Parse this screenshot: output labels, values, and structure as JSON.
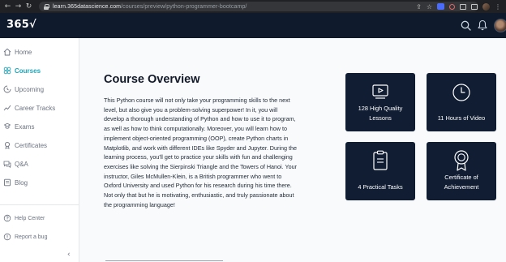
{
  "browser": {
    "url_host": "learn.365datascience.com",
    "url_path": "/courses/preview/python-programmer-bootcamp/"
  },
  "header": {
    "logo": "365√"
  },
  "sidebar": {
    "items": [
      {
        "label": "Home",
        "icon": "home-icon"
      },
      {
        "label": "Courses",
        "icon": "courses-icon",
        "active": true
      },
      {
        "label": "Upcoming",
        "icon": "upcoming-icon"
      },
      {
        "label": "Career Tracks",
        "icon": "career-tracks-icon"
      },
      {
        "label": "Exams",
        "icon": "exams-icon"
      },
      {
        "label": "Certificates",
        "icon": "certificates-icon"
      },
      {
        "label": "Q&A",
        "icon": "qa-icon"
      },
      {
        "label": "Blog",
        "icon": "blog-icon"
      }
    ],
    "footer_items": [
      {
        "label": "Help Center",
        "icon": "help-icon"
      },
      {
        "label": "Report a bug",
        "icon": "bug-icon"
      }
    ],
    "collapse_glyph": "‹"
  },
  "main": {
    "title": "Course Overview",
    "description": "This Python course will not only take your programming skills to the next level, but also give you a problem-solving superpower! In it, you will develop a thorough understanding of Python and how to use it to program, as well as how to think computationally. Moreover, you will learn how to implement object-oriented programming (OOP), create Python charts in Matplotlib, and work with different IDEs like Spyder and Jupyter. During the learning process, you'll get to practice your skills with fun and challenging exercises like solving the Sierpinski Triangle and the Towers of Hanoi. Your instructor, Giles McMullen-Klein, is a British programmer who went to Oxford University and used Python for his research during his time there. Not only that but he is motivating, enthusiastic, and truly passionate about the programming language!"
  },
  "cards": [
    {
      "line1": "128 High Quality",
      "line2": "Lessons",
      "icon": "video-lesson-icon"
    },
    {
      "line1": "11 Hours of Video",
      "line2": "",
      "icon": "clock-icon"
    },
    {
      "line1": "4 Practical Tasks",
      "line2": "",
      "icon": "task-clipboard-icon"
    },
    {
      "line1": "Certificate of",
      "line2": "Achievement",
      "icon": "certificate-medal-icon"
    }
  ],
  "colors": {
    "header_bg": "#0f1a2c",
    "card_bg": "#101d33",
    "accent": "#1fa5b8"
  }
}
